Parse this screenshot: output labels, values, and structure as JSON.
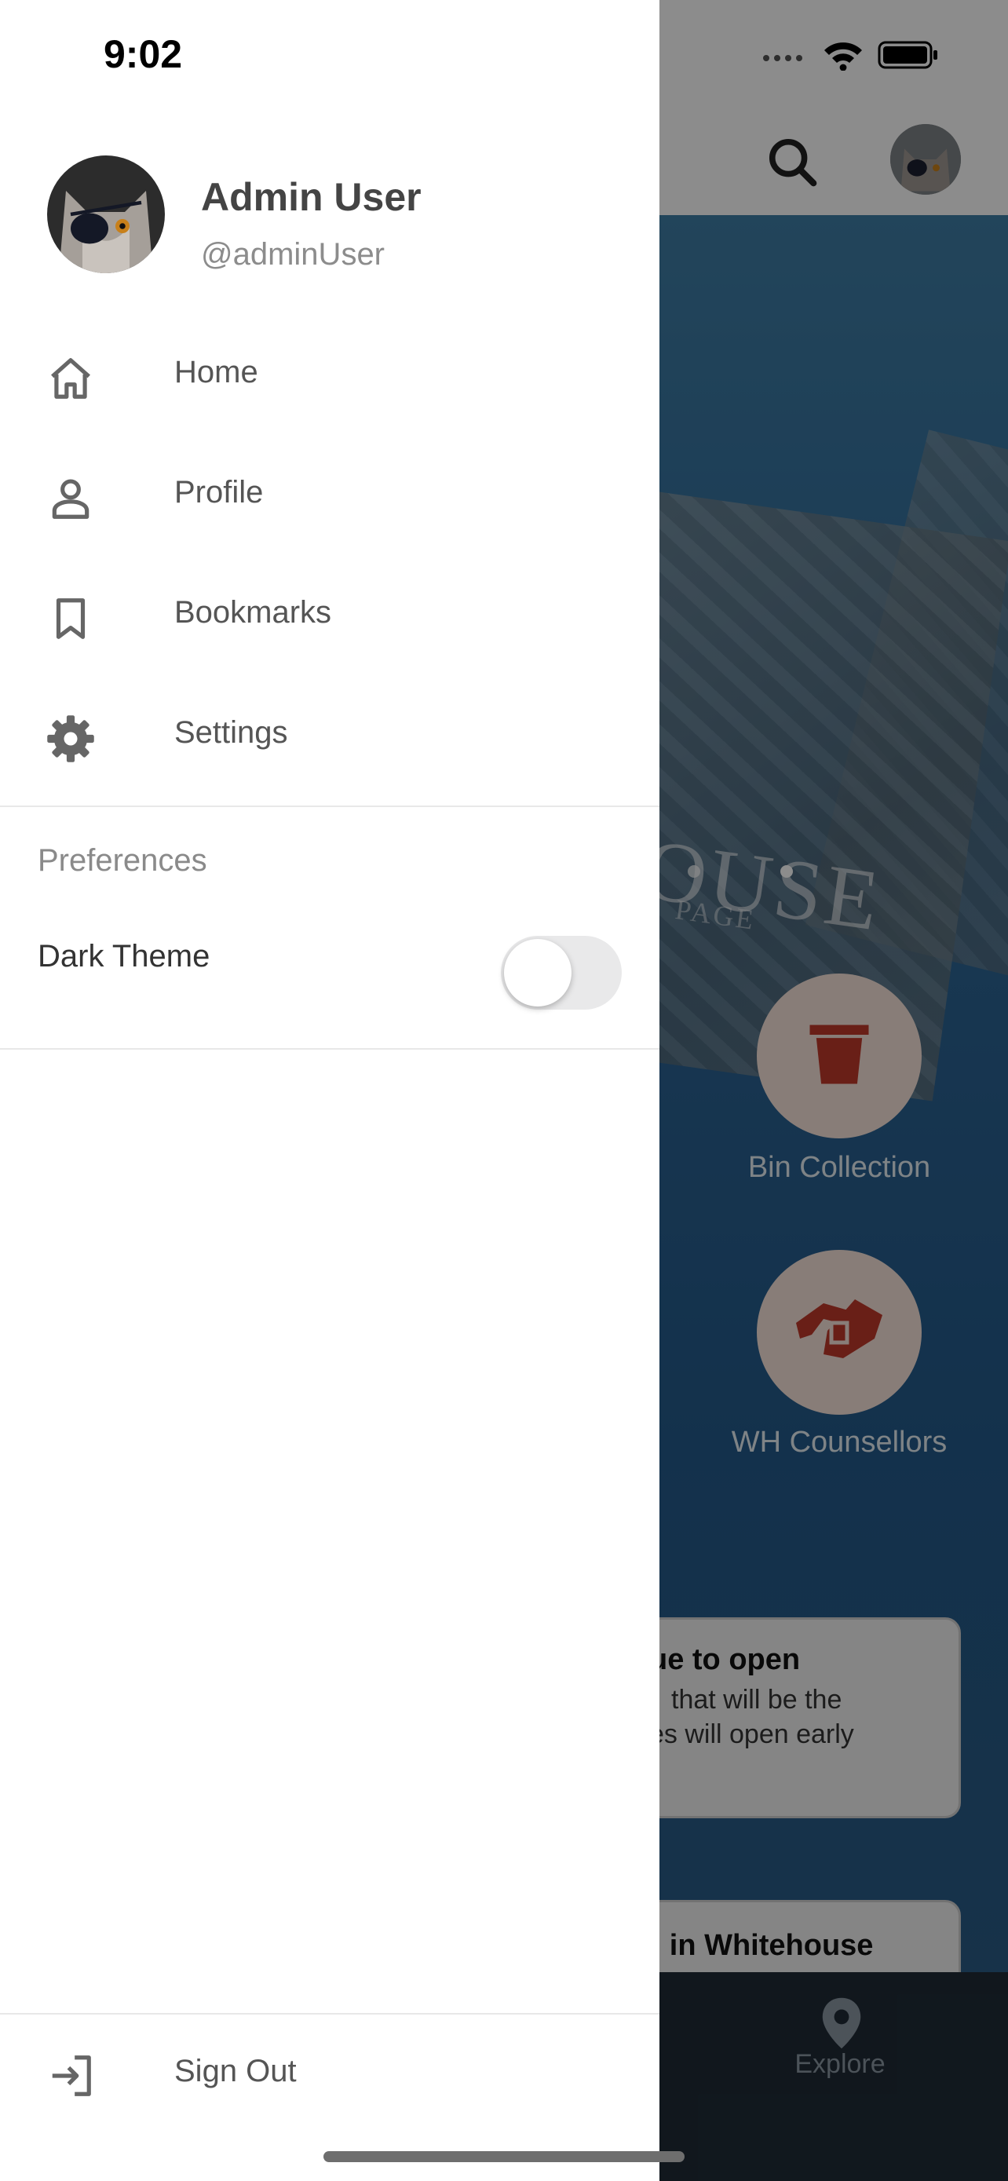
{
  "status_bar": {
    "time": "9:02"
  },
  "drawer": {
    "user": {
      "name": "Admin User",
      "handle": "@adminUser"
    },
    "menu": [
      {
        "label": "Home",
        "icon": "home-icon"
      },
      {
        "label": "Profile",
        "icon": "person-icon"
      },
      {
        "label": "Bookmarks",
        "icon": "bookmark-icon"
      },
      {
        "label": "Settings",
        "icon": "gear-icon"
      }
    ],
    "preferences": {
      "title": "Preferences",
      "dark_theme_label": "Dark Theme",
      "dark_theme_on": false
    },
    "sign_out_label": "Sign Out"
  },
  "background_app": {
    "banner_title": "OUSE",
    "banner_subtitle": "PAGE",
    "services": [
      {
        "label": "Bin Collection",
        "icon": "bin-icon"
      },
      {
        "label": "WH Counsellors",
        "icon": "handshake-icon"
      }
    ],
    "cards": [
      {
        "title": "ue to open",
        "line1": "that will be the",
        "line2": "es will open early"
      },
      {
        "title": "d in Whitehouse"
      }
    ],
    "nav": {
      "explore_label": "Explore"
    }
  },
  "colors": {
    "accent": "#c0392b",
    "overlay": "rgba(0,0,0,0.45)"
  }
}
